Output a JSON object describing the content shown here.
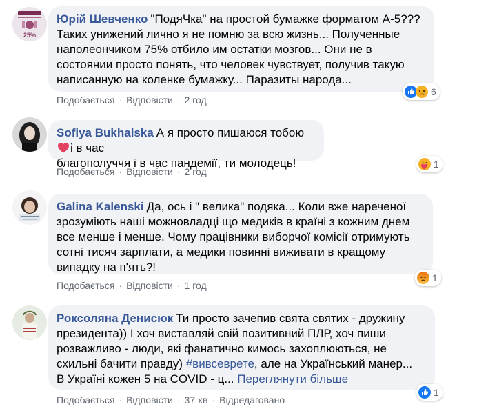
{
  "comments": [
    {
      "author": "Юрій Шевченко",
      "lines": [
        "\"ПодяЧка\" на простой бумажке форматом А-5???",
        "Таких унижений лично я не помню за всю жизнь... Полученные",
        "наполеончиком 75% отбило им остатки мозгов... Они не в",
        "состоянии просто понять, что человек чувствует, получив такую",
        "написанную на коленке бумажку... Паразиты народа..."
      ],
      "avatar_badge": "25%",
      "actions": [
        "Подобається",
        "Відповісти",
        "2 год"
      ],
      "reactions": [
        "like-icon",
        "sad-icon"
      ],
      "reaction_count": "6"
    },
    {
      "author": "Sofiya Bukhalska",
      "lines": [
        "А я просто пишаюся тобою",
        "і в час",
        "благополуччя і в час пандемії, ти молодець!"
      ],
      "actions": [
        "Подобається",
        "Відповісти",
        "2 год"
      ],
      "reactions": [
        "care-icon"
      ],
      "reaction_count": "1"
    },
    {
      "author": "Galina Kalenski",
      "lines": [
        "Да, ось і \" велика\" подяка... Коли вже нареченої",
        "зрозуміють наші можновладці що медиків в країні з кожним днем",
        "все менше і менше. Чому працівники виборчої комісії отримують",
        "сотні тисяч зарплати, а медики повинні виживати в кращому",
        "випадку на п'ять?!"
      ],
      "actions": [
        "Подобається",
        "Відповісти",
        "1 год"
      ],
      "reactions": [
        "angry-icon"
      ],
      "reaction_count": "1"
    },
    {
      "author": "Роксоляна Денисюк",
      "lines": [
        "Ти просто зачепив свята святих - дружину",
        "президента)) І хоч виставляй свій позитивний ПЛР, хоч пиши",
        "розважливо - люди, які фанатично кимось захоплюються, не",
        "схильні бачити правду)",
        "#вивсеврете",
        ", але на Український манер...",
        "В Україні кожен 5 на COVID - ц...",
        "Переглянути більше"
      ],
      "actions": [
        "Подобається",
        "Відповісти",
        "37 хв",
        "Відредаговано"
      ],
      "reactions": [
        "like-icon"
      ],
      "reaction_count": "1"
    }
  ],
  "colors": {
    "bubble": "#f0f2f5",
    "author": "#385898",
    "action_text": "#606770",
    "like": "#1877f2",
    "heart": "#e4405f"
  }
}
